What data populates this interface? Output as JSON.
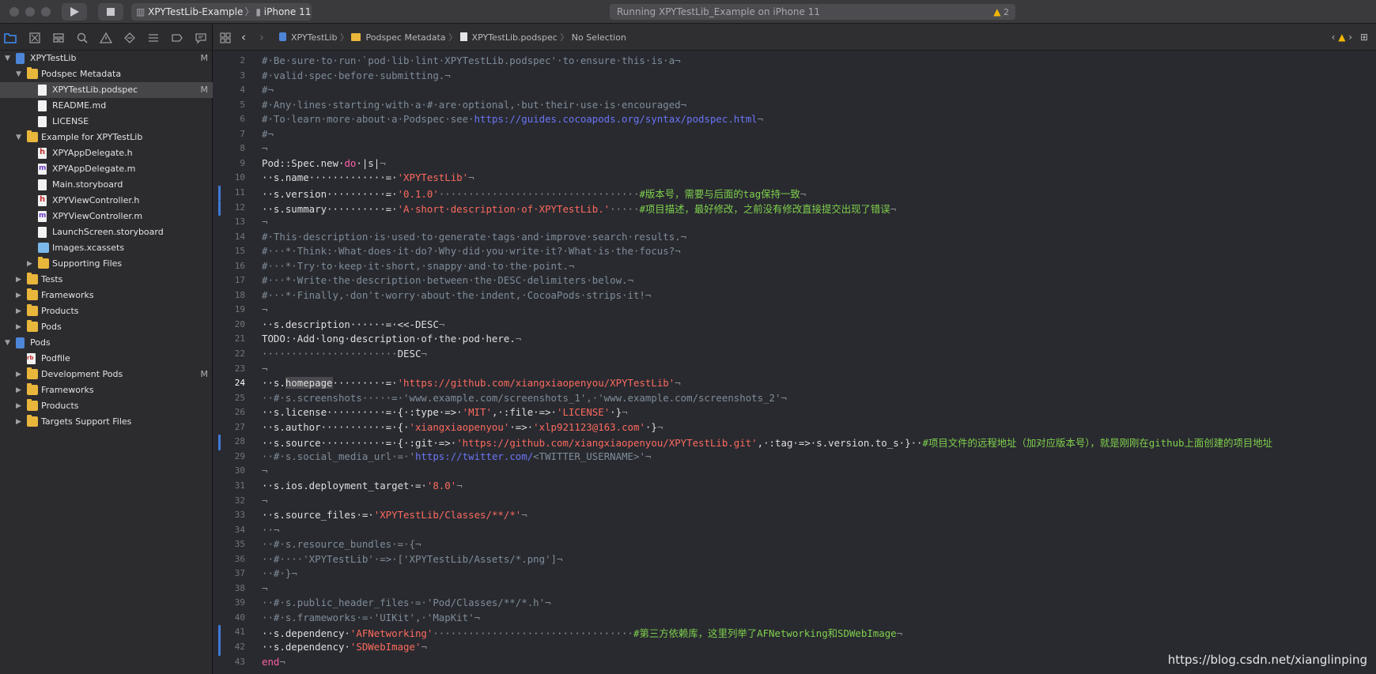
{
  "titlebar": {
    "scheme_target": "XPYTestLib-Example",
    "separator": "〉",
    "device": "iPhone 11",
    "status_text": "Running XPYTestLib_Example on iPhone 11",
    "warning_count": "2"
  },
  "navigator": {
    "rows": [
      {
        "label": "XPYTestLib",
        "depth": 0,
        "disclosure": "open",
        "icon": "project-icon",
        "mark": "M"
      },
      {
        "label": "Podspec Metadata",
        "depth": 1,
        "disclosure": "open",
        "icon": "folder-icon",
        "mark": ""
      },
      {
        "label": "XPYTestLib.podspec",
        "depth": 2,
        "disclosure": "",
        "icon": "document-icon",
        "mark": "M",
        "selected": true
      },
      {
        "label": "README.md",
        "depth": 2,
        "disclosure": "",
        "icon": "document-icon",
        "mark": ""
      },
      {
        "label": "LICENSE",
        "depth": 2,
        "disclosure": "",
        "icon": "document-icon",
        "mark": ""
      },
      {
        "label": "Example for XPYTestLib",
        "depth": 1,
        "disclosure": "open",
        "icon": "folder-icon",
        "mark": ""
      },
      {
        "label": "XPYAppDelegate.h",
        "depth": 2,
        "disclosure": "",
        "icon": "header-file-icon",
        "mark": ""
      },
      {
        "label": "XPYAppDelegate.m",
        "depth": 2,
        "disclosure": "",
        "icon": "objc-file-icon",
        "mark": ""
      },
      {
        "label": "Main.storyboard",
        "depth": 2,
        "disclosure": "",
        "icon": "storyboard-icon",
        "mark": ""
      },
      {
        "label": "XPYViewController.h",
        "depth": 2,
        "disclosure": "",
        "icon": "header-file-icon",
        "mark": ""
      },
      {
        "label": "XPYViewController.m",
        "depth": 2,
        "disclosure": "",
        "icon": "objc-file-icon",
        "mark": ""
      },
      {
        "label": "LaunchScreen.storyboard",
        "depth": 2,
        "disclosure": "",
        "icon": "storyboard-icon",
        "mark": ""
      },
      {
        "label": "Images.xcassets",
        "depth": 2,
        "disclosure": "",
        "icon": "assets-icon",
        "mark": ""
      },
      {
        "label": "Supporting Files",
        "depth": 2,
        "disclosure": "closed",
        "icon": "folder-icon",
        "mark": ""
      },
      {
        "label": "Tests",
        "depth": 1,
        "disclosure": "closed",
        "icon": "folder-icon",
        "mark": ""
      },
      {
        "label": "Frameworks",
        "depth": 1,
        "disclosure": "closed",
        "icon": "folder-icon",
        "mark": ""
      },
      {
        "label": "Products",
        "depth": 1,
        "disclosure": "closed",
        "icon": "folder-icon",
        "mark": ""
      },
      {
        "label": "Pods",
        "depth": 1,
        "disclosure": "closed",
        "icon": "folder-icon",
        "mark": ""
      },
      {
        "label": "Pods",
        "depth": 0,
        "disclosure": "open",
        "icon": "project-icon",
        "mark": ""
      },
      {
        "label": "Podfile",
        "depth": 1,
        "disclosure": "",
        "icon": "ruby-file-icon",
        "mark": ""
      },
      {
        "label": "Development Pods",
        "depth": 1,
        "disclosure": "closed",
        "icon": "folder-icon",
        "mark": "M"
      },
      {
        "label": "Frameworks",
        "depth": 1,
        "disclosure": "closed",
        "icon": "folder-icon",
        "mark": ""
      },
      {
        "label": "Products",
        "depth": 1,
        "disclosure": "closed",
        "icon": "folder-icon",
        "mark": ""
      },
      {
        "label": "Targets Support Files",
        "depth": 1,
        "disclosure": "closed",
        "icon": "folder-icon",
        "mark": ""
      }
    ]
  },
  "jumpbar": {
    "crumb_1": "XPYTestLib",
    "crumb_2": "Podspec Metadata",
    "crumb_3": "XPYTestLib.podspec",
    "crumb_4": "No Selection",
    "separator": "〉"
  },
  "editor": {
    "current_line": 24,
    "changed_lines": [
      11,
      12,
      28,
      41,
      42
    ],
    "lines": [
      {
        "n": 2,
        "spans": [
          [
            "c",
            "#·Be·sure·to·run·`pod·lib·lint·XPYTestLib.podspec'·to·ensure·this·is·a¬"
          ]
        ]
      },
      {
        "n": 3,
        "spans": [
          [
            "c",
            "#·valid·spec·before·submitting.¬"
          ]
        ]
      },
      {
        "n": 4,
        "spans": [
          [
            "c",
            "#¬"
          ]
        ]
      },
      {
        "n": 5,
        "spans": [
          [
            "c",
            "#·Any·lines·starting·with·a·#·are·optional,·but·their·use·is·encouraged¬"
          ]
        ]
      },
      {
        "n": 6,
        "spans": [
          [
            "c",
            "#·To·learn·more·about·a·Podspec·see·"
          ],
          [
            "u",
            "https://guides.cocoapods.org/syntax/podspec.html"
          ],
          [
            "c",
            "¬"
          ]
        ]
      },
      {
        "n": 7,
        "spans": [
          [
            "c",
            "#¬"
          ]
        ]
      },
      {
        "n": 8,
        "spans": [
          [
            "iv",
            "¬"
          ]
        ]
      },
      {
        "n": 9,
        "spans": [
          [
            "",
            "Pod::Spec.new·"
          ],
          [
            "k",
            "do"
          ],
          [
            "",
            "·|s|"
          ],
          [
            "iv",
            "¬"
          ]
        ]
      },
      {
        "n": 10,
        "spans": [
          [
            "",
            "··s.name·············=·"
          ],
          [
            "s",
            "'XPYTestLib'"
          ],
          [
            "iv",
            "¬"
          ]
        ]
      },
      {
        "n": 11,
        "spans": [
          [
            "",
            "··s.version··········=·"
          ],
          [
            "s",
            "'0.1.0'"
          ],
          [
            "iv",
            "··································"
          ],
          [
            "cn",
            "#版本号，需要与后面的tag保持一致"
          ],
          [
            "iv",
            "¬"
          ]
        ]
      },
      {
        "n": 12,
        "spans": [
          [
            "",
            "··s.summary··········=·"
          ],
          [
            "s",
            "'A·short·description·of·XPYTestLib.'"
          ],
          [
            "iv",
            "·····"
          ],
          [
            "cn",
            "#项目描述，最好修改，之前没有修改直接提交出现了错误"
          ],
          [
            "iv",
            "¬"
          ]
        ]
      },
      {
        "n": 13,
        "spans": [
          [
            "iv",
            "¬"
          ]
        ]
      },
      {
        "n": 14,
        "spans": [
          [
            "c",
            "#·This·description·is·used·to·generate·tags·and·improve·search·results.¬"
          ]
        ]
      },
      {
        "n": 15,
        "spans": [
          [
            "c",
            "#···*·Think:·What·does·it·do?·Why·did·you·write·it?·What·is·the·focus?¬"
          ]
        ]
      },
      {
        "n": 16,
        "spans": [
          [
            "c",
            "#···*·Try·to·keep·it·short,·snappy·and·to·the·point.¬"
          ]
        ]
      },
      {
        "n": 17,
        "spans": [
          [
            "c",
            "#···*·Write·the·description·between·the·DESC·delimiters·below.¬"
          ]
        ]
      },
      {
        "n": 18,
        "spans": [
          [
            "c",
            "#···*·Finally,·don't·worry·about·the·indent,·CocoaPods·strips·it!¬"
          ]
        ]
      },
      {
        "n": 19,
        "spans": [
          [
            "iv",
            "¬"
          ]
        ]
      },
      {
        "n": 20,
        "spans": [
          [
            "",
            "··s.description······=·<<-DESC"
          ],
          [
            "iv",
            "¬"
          ]
        ]
      },
      {
        "n": 21,
        "spans": [
          [
            "",
            "TODO:·Add·long·description·of·the·pod·here."
          ],
          [
            "iv",
            "¬"
          ]
        ]
      },
      {
        "n": 22,
        "spans": [
          [
            "iv",
            "·······················"
          ],
          [
            "",
            "DESC"
          ],
          [
            "iv",
            "¬"
          ]
        ]
      },
      {
        "n": 23,
        "spans": [
          [
            "iv",
            "¬"
          ]
        ]
      },
      {
        "n": 24,
        "spans": [
          [
            "",
            "··s."
          ],
          [
            "hl",
            "homepage"
          ],
          [
            "",
            "·········=·"
          ],
          [
            "s",
            "'https://github.com/xiangxiaopenyou/XPYTestLib'"
          ],
          [
            "iv",
            "¬"
          ]
        ]
      },
      {
        "n": 25,
        "spans": [
          [
            "c",
            "··#·s.screenshots·····=·'www.example.com/screenshots_1',·'www.example.com/screenshots_2'¬"
          ]
        ]
      },
      {
        "n": 26,
        "spans": [
          [
            "",
            "··s.license··········=·{·:type·=>·"
          ],
          [
            "s",
            "'MIT'"
          ],
          [
            "",
            ",·:file·=>·"
          ],
          [
            "s",
            "'LICENSE'"
          ],
          [
            "",
            "·}"
          ],
          [
            "iv",
            "¬"
          ]
        ]
      },
      {
        "n": 27,
        "spans": [
          [
            "",
            "··s.author···········=·{·"
          ],
          [
            "s",
            "'xiangxiaopenyou'"
          ],
          [
            "",
            "·=>·"
          ],
          [
            "s",
            "'xlp921123@163.com'"
          ],
          [
            "",
            "·}"
          ],
          [
            "iv",
            "¬"
          ]
        ]
      },
      {
        "n": 28,
        "spans": [
          [
            "",
            "··s.source···········=·{·:git·=>·"
          ],
          [
            "s",
            "'https://github.com/xiangxiaopenyou/XPYTestLib.git'"
          ],
          [
            "",
            ",·:tag·=>·s.version.to_s·}··"
          ],
          [
            "cn",
            "#项目文件的远程地址（加对应版本号），就是刚刚在github上面创建的项目地址"
          ]
        ]
      },
      {
        "n": 29,
        "spans": [
          [
            "c",
            "··#·s.social_media_url·=·'"
          ],
          [
            "u",
            "https://twitter.com/"
          ],
          [
            "c",
            "<TWITTER_USERNAME>'¬"
          ]
        ]
      },
      {
        "n": 30,
        "spans": [
          [
            "iv",
            "¬"
          ]
        ]
      },
      {
        "n": 31,
        "spans": [
          [
            "",
            "··s.ios.deployment_target·=·"
          ],
          [
            "s",
            "'8.0'"
          ],
          [
            "iv",
            "¬"
          ]
        ]
      },
      {
        "n": 32,
        "spans": [
          [
            "iv",
            "¬"
          ]
        ]
      },
      {
        "n": 33,
        "spans": [
          [
            "",
            "··s.source_files·=·"
          ],
          [
            "s",
            "'XPYTestLib/Classes/**/*'"
          ],
          [
            "iv",
            "¬"
          ]
        ]
      },
      {
        "n": 34,
        "spans": [
          [
            "iv",
            "··¬"
          ]
        ]
      },
      {
        "n": 35,
        "spans": [
          [
            "c",
            "··#·s.resource_bundles·=·{¬"
          ]
        ]
      },
      {
        "n": 36,
        "spans": [
          [
            "c",
            "··#····'XPYTestLib'·=>·['XPYTestLib/Assets/*.png']¬"
          ]
        ]
      },
      {
        "n": 37,
        "spans": [
          [
            "c",
            "··#·}¬"
          ]
        ]
      },
      {
        "n": 38,
        "spans": [
          [
            "iv",
            "¬"
          ]
        ]
      },
      {
        "n": 39,
        "spans": [
          [
            "c",
            "··#·s.public_header_files·=·'Pod/Classes/**/*.h'¬"
          ]
        ]
      },
      {
        "n": 40,
        "spans": [
          [
            "c",
            "··#·s.frameworks·=·'UIKit',·'MapKit'¬"
          ]
        ]
      },
      {
        "n": 41,
        "spans": [
          [
            "",
            "··s.dependency·"
          ],
          [
            "s",
            "'AFNetworking'"
          ],
          [
            "iv",
            "··································"
          ],
          [
            "cn",
            "#第三方依赖库，这里列举了AFNetworking和SDWebImage"
          ],
          [
            "iv",
            "¬"
          ]
        ]
      },
      {
        "n": 42,
        "spans": [
          [
            "",
            "··s.dependency·"
          ],
          [
            "s",
            "'SDWebImage'"
          ],
          [
            "iv",
            "¬"
          ]
        ]
      },
      {
        "n": 43,
        "spans": [
          [
            "k",
            "end"
          ],
          [
            "iv",
            "¬"
          ]
        ]
      }
    ]
  },
  "watermark": "https://blog.csdn.net/xianglinping",
  "colors": {
    "comment": "#7f8c98",
    "string": "#fc6a5d",
    "keyword": "#fc5fa3",
    "url": "#6a75f5",
    "chinese_comment": "#7fd04c",
    "folder": "#e9b63c",
    "warning": "#f2b705",
    "change_bar": "#3e7ad6"
  }
}
